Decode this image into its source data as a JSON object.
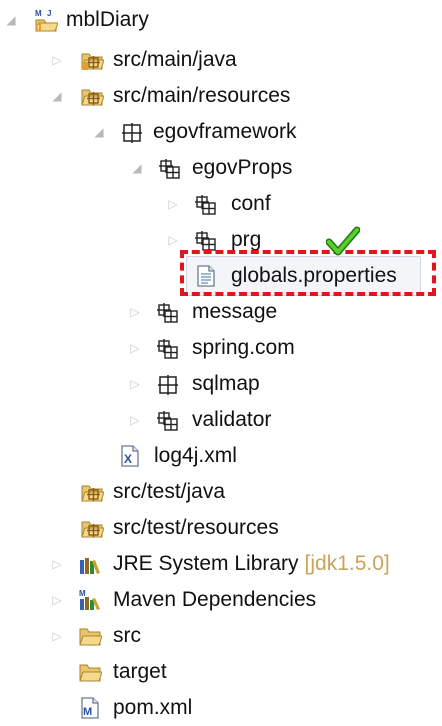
{
  "tree": {
    "project": "mblDiary",
    "src_main_java": "src/main/java",
    "src_main_resources": "src/main/resources",
    "egovframework": "egovframework",
    "egovProps": "egovProps",
    "conf": "conf",
    "prg": "prg",
    "globals_properties": "globals.properties",
    "message": "message",
    "spring_com": "spring.com",
    "sqlmap": "sqlmap",
    "validator": "validator",
    "log4j": "log4j.xml",
    "src_test_java": "src/test/java",
    "src_test_resources": "src/test/resources",
    "jre_library": "JRE System Library",
    "jre_version": "[jdk1.5.0]",
    "maven_deps": "Maven Dependencies",
    "src": "src",
    "target": "target",
    "pom": "pom.xml"
  },
  "icons": {
    "project": "maven-project-icon",
    "source_folder": "source-folder-icon",
    "package": "package-icon",
    "empty_package": "empty-package-icon",
    "properties_file": "properties-file-icon",
    "xml_file": "xml-file-icon",
    "library": "library-icon",
    "folder": "folder-icon",
    "checkmark": "checkmark-icon"
  },
  "colors": {
    "highlight_border": "#e3141d",
    "selection_bg": "#f3f5f9",
    "decoration": "#c9a35a"
  }
}
